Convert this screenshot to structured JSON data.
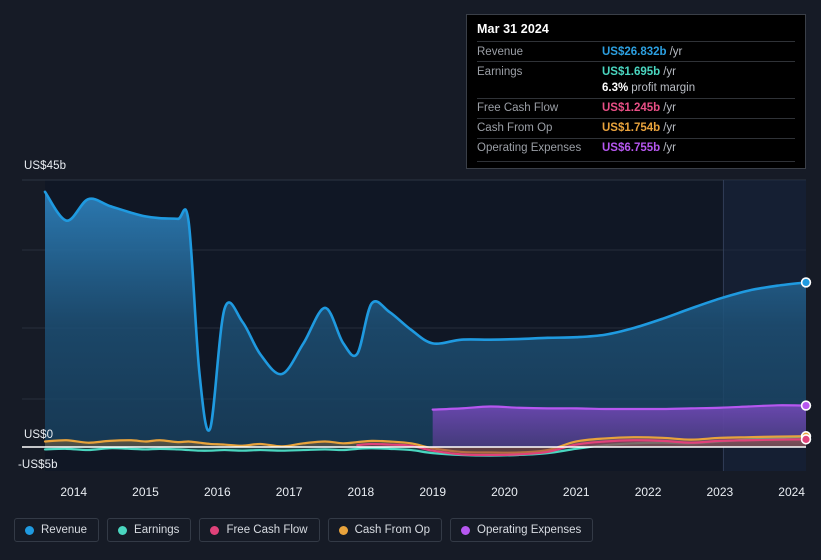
{
  "tooltip": {
    "date": "Mar 31 2024",
    "rows": [
      {
        "label": "Revenue",
        "value": "US$26.832b",
        "unit": "/yr",
        "color": "#2c9fe0"
      },
      {
        "label": "Earnings",
        "value": "US$1.695b",
        "unit": "/yr",
        "color": "#4ad6c0"
      },
      {
        "label": "Free Cash Flow",
        "value": "US$1.245b",
        "unit": "/yr",
        "color": "#e84f86"
      },
      {
        "label": "Cash From Op",
        "value": "US$1.754b",
        "unit": "/yr",
        "color": "#e8a33c"
      },
      {
        "label": "Operating Expenses",
        "value": "US$6.755b",
        "unit": "/yr",
        "color": "#b657f0"
      }
    ],
    "margin_value": "6.3%",
    "margin_label": "profit margin"
  },
  "legend": {
    "items": [
      {
        "label": "Revenue",
        "color": "#1f9ae0"
      },
      {
        "label": "Earnings",
        "color": "#4ad6c0"
      },
      {
        "label": "Free Cash Flow",
        "color": "#e0427a"
      },
      {
        "label": "Cash From Op",
        "color": "#e8a33c"
      },
      {
        "label": "Operating Expenses",
        "color": "#b657f0"
      }
    ]
  },
  "axes": {
    "y_top_label": "US$45b",
    "y_zero_label": "US$0",
    "y_bottom_label": "-US$5b",
    "x_labels": [
      "2014",
      "2015",
      "2016",
      "2017",
      "2018",
      "2019",
      "2020",
      "2021",
      "2022",
      "2023",
      "2024"
    ]
  },
  "chart_data": {
    "type": "area",
    "title": "",
    "xlabel": "",
    "ylabel": "US$",
    "ylim": [
      -5,
      45
    ],
    "grid": true,
    "legend_position": "bottom",
    "x": [
      2013.6,
      2013.9,
      2014.2,
      2014.5,
      2014.8,
      2015.0,
      2015.2,
      2015.45,
      2015.6,
      2015.75,
      2015.9,
      2016.1,
      2016.35,
      2016.6,
      2016.9,
      2017.2,
      2017.5,
      2017.75,
      2017.95,
      2018.15,
      2018.4,
      2018.7,
      2019.0,
      2019.4,
      2019.8,
      2020.2,
      2020.6,
      2021.0,
      2021.4,
      2021.8,
      2022.2,
      2022.6,
      2023.0,
      2023.4,
      2023.8,
      2024.2
    ],
    "x_tick_values": [
      2014,
      2015,
      2016,
      2017,
      2018,
      2019,
      2020,
      2021,
      2022,
      2023,
      2024
    ],
    "series": [
      {
        "name": "Revenue",
        "color": "#1f9ae0",
        "fill": true,
        "end_marker": true,
        "values": [
          41.6,
          36.9,
          40.4,
          39.3,
          38.2,
          37.6,
          37.3,
          37.2,
          36.8,
          12.2,
          3.0,
          22.5,
          20.4,
          15.1,
          11.9,
          16.9,
          22.7,
          17.0,
          15.2,
          23.4,
          22.0,
          19.1,
          16.9,
          17.5,
          17.5,
          17.6,
          17.8,
          17.9,
          18.3,
          19.4,
          20.9,
          22.6,
          24.2,
          25.5,
          26.3,
          26.832
        ]
      },
      {
        "name": "Operating Expenses",
        "color": "#b657f0",
        "fill": true,
        "end_marker": true,
        "start_x": 2019.0,
        "values": [
          null,
          null,
          null,
          null,
          null,
          null,
          null,
          null,
          null,
          null,
          null,
          null,
          null,
          null,
          null,
          null,
          null,
          null,
          null,
          null,
          null,
          null,
          6.1,
          6.3,
          6.6,
          6.4,
          6.3,
          6.3,
          6.2,
          6.2,
          6.2,
          6.3,
          6.4,
          6.6,
          6.8,
          6.755
        ]
      },
      {
        "name": "Cash From Op",
        "color": "#e8a33c",
        "fill": true,
        "end_marker": true,
        "values": [
          0.9,
          1.1,
          0.7,
          1.0,
          1.1,
          0.9,
          1.1,
          0.8,
          0.9,
          0.7,
          0.5,
          0.4,
          0.2,
          0.5,
          0.1,
          0.6,
          0.9,
          0.6,
          0.8,
          1.0,
          0.9,
          0.6,
          -0.2,
          -0.8,
          -0.9,
          -0.9,
          -0.5,
          0.9,
          1.4,
          1.6,
          1.5,
          1.2,
          1.5,
          1.6,
          1.7,
          1.754
        ]
      },
      {
        "name": "Free Cash Flow",
        "color": "#e0427a",
        "fill": true,
        "end_marker": true,
        "start_x": 2018.1,
        "values": [
          null,
          null,
          null,
          null,
          null,
          null,
          null,
          null,
          null,
          null,
          null,
          null,
          null,
          null,
          null,
          null,
          null,
          null,
          0.3,
          0.5,
          0.4,
          0.2,
          -0.6,
          -1.2,
          -1.3,
          -1.2,
          -0.8,
          0.4,
          0.9,
          1.1,
          1.0,
          0.7,
          1.0,
          1.1,
          1.2,
          1.245
        ]
      },
      {
        "name": "Earnings",
        "color": "#4ad6c0",
        "fill": true,
        "end_marker": false,
        "values": [
          -0.4,
          -0.3,
          -0.5,
          -0.2,
          -0.3,
          -0.4,
          -0.3,
          -0.4,
          -0.5,
          -0.6,
          -0.6,
          -0.5,
          -0.6,
          -0.5,
          -0.6,
          -0.5,
          -0.4,
          -0.5,
          -0.3,
          -0.2,
          -0.3,
          -0.5,
          -1.0,
          -1.3,
          -1.4,
          -1.3,
          -1.0,
          -0.3,
          0.3,
          0.6,
          0.7,
          0.6,
          0.9,
          1.2,
          1.5,
          1.695
        ]
      }
    ],
    "forecast_divider_x": 2023.05,
    "annotations": []
  },
  "colors": {
    "background": "#161b26",
    "plot_background": "#0f1420",
    "gridline": "#2d3748",
    "zero_line": "#ffffff",
    "axis_text": "#e9edf2"
  }
}
